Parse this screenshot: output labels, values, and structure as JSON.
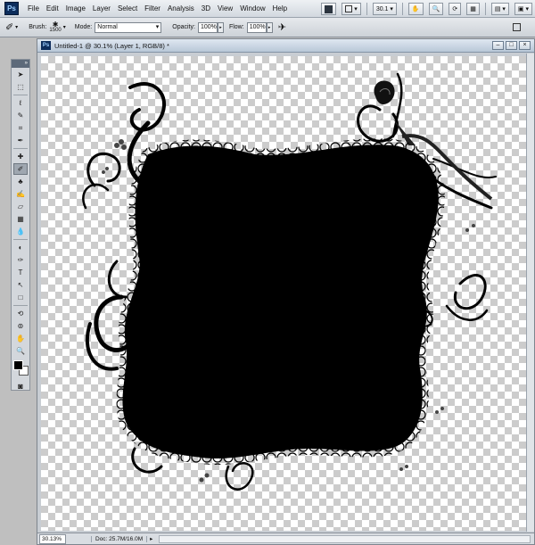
{
  "menubar": {
    "logo": "Ps",
    "items": [
      "File",
      "Edit",
      "Image",
      "Layer",
      "Select",
      "Filter",
      "Analysis",
      "3D",
      "View",
      "Window",
      "Help"
    ],
    "zoom_value": "30.1"
  },
  "options": {
    "brush_label": "Brush:",
    "brush_size": "1500",
    "mode_label": "Mode:",
    "mode_value": "Normal",
    "opacity_label": "Opacity:",
    "opacity_value": "100%",
    "flow_label": "Flow:",
    "flow_value": "100%"
  },
  "tools": [
    {
      "name": "move-tool",
      "glyph": "➤"
    },
    {
      "name": "marquee-tool",
      "glyph": "⬚"
    },
    {
      "name": "lasso-tool",
      "glyph": "ℓ"
    },
    {
      "name": "quick-select-tool",
      "glyph": "✎"
    },
    {
      "name": "crop-tool",
      "glyph": "⌗"
    },
    {
      "name": "eyedropper-tool",
      "glyph": "✒"
    },
    {
      "name": "healing-tool",
      "glyph": "✚"
    },
    {
      "name": "brush-tool",
      "glyph": "✐",
      "active": true
    },
    {
      "name": "clone-stamp-tool",
      "glyph": "♣"
    },
    {
      "name": "history-brush-tool",
      "glyph": "✍"
    },
    {
      "name": "eraser-tool",
      "glyph": "▱"
    },
    {
      "name": "gradient-tool",
      "glyph": "▦"
    },
    {
      "name": "blur-tool",
      "glyph": "💧"
    },
    {
      "name": "dodge-tool",
      "glyph": "◐"
    },
    {
      "name": "pen-tool",
      "glyph": "✑"
    },
    {
      "name": "type-tool",
      "glyph": "T"
    },
    {
      "name": "path-select-tool",
      "glyph": "↖"
    },
    {
      "name": "shape-tool",
      "glyph": "□"
    },
    {
      "name": "3d-rotate-tool",
      "glyph": "⟲"
    },
    {
      "name": "3d-orbit-tool",
      "glyph": "⊚"
    },
    {
      "name": "hand-tool",
      "glyph": "✋"
    },
    {
      "name": "zoom-tool",
      "glyph": "🔍"
    }
  ],
  "document": {
    "icon": "Ps",
    "title": "Untitled-1 @ 30.1% (Layer 1, RGB/8) *",
    "zoom": "30.13%",
    "doc_info": "Doc: 25.7M/16.0M"
  },
  "colors": {
    "foreground": "#000000",
    "background": "#ffffff"
  }
}
